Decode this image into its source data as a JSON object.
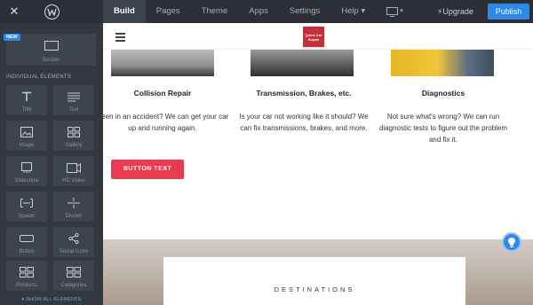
{
  "topbar": {
    "nav": [
      "Build",
      "Pages",
      "Theme",
      "Apps",
      "Settings",
      "Help ▾"
    ],
    "device_menu": "▾",
    "upgrade": "⚡Upgrade",
    "publish": "Publish"
  },
  "sidebar": {
    "new_badge": "NEW",
    "section_tile": "Section",
    "group_label": "INDIVIDUAL ELEMENTS",
    "elements": [
      "Title",
      "Text",
      "Image",
      "Gallery",
      "Slideshow",
      "HD Video",
      "Spacer",
      "Divider",
      "Button",
      "Social Icons",
      "Products",
      "Categories"
    ],
    "show_all": "▾ SHOW ALL ELEMENTS"
  },
  "site": {
    "logo_text": "Quick Car Repair",
    "services": [
      {
        "title": "Collision Repair",
        "text": "Been in an accident? We can get your car up and running again."
      },
      {
        "title": "Transmission, Brakes, etc.",
        "text": "Is your car not working like it should? We can fix transmissions, brakes, and more."
      },
      {
        "title": "Diagnostics",
        "text": "Not sure what's wrong? We can run diagnostic tests to figure out the problem and fix it."
      }
    ],
    "button_text": "BUTTON TEXT",
    "destinations_title": "DESTINATIONS"
  },
  "colors": {
    "topbar": "#2c3036",
    "sidebar": "#33383e",
    "accent_blue": "#2b89e8",
    "cta_red": "#ea3a50",
    "logo_red": "#c62f3a"
  }
}
